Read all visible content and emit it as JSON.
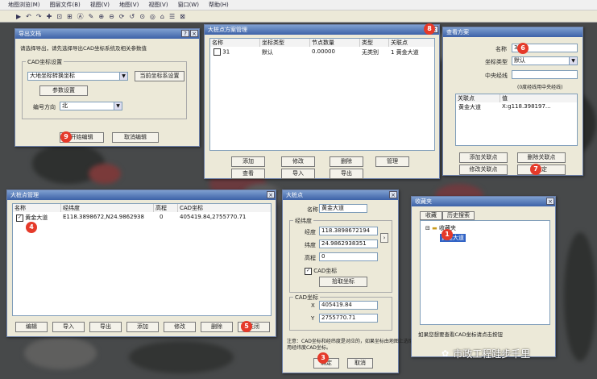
{
  "menubar": {
    "items": [
      "地图浏览(M)",
      "图层文件(B)",
      "视图(V)",
      "地图(V)",
      "视图(V)",
      "窗口(W)",
      "帮助(H)"
    ]
  },
  "toolbar": {
    "glyphs": [
      "▶",
      "↶",
      "↷",
      "✚",
      "⊡",
      "⊞",
      "Ⓐ",
      "✎",
      "⊕",
      "⊖",
      "⟳",
      "↺",
      "⊙",
      "◎",
      "⌂",
      "☰",
      "⊠"
    ]
  },
  "export_win": {
    "title": "导出文档",
    "instruction": "请选择导出，请先选择导出CAD坐标系统及相关参数值",
    "cad_group": "CAD坐标设置",
    "coord_select": "大地坐标转换坐标",
    "cur_coord_btn": "当前坐标系设置",
    "param_btn": "参数设置",
    "dir_label": "编号方向",
    "dir_value": "北",
    "ok_btn": "开始编辑",
    "cancel_btn": "取消编辑",
    "marker": "9"
  },
  "plan_win": {
    "title": "大桩点方案管理",
    "headers": [
      "名称",
      "坐标类型",
      "节点数量",
      "类型",
      "关联点"
    ],
    "row": {
      "name": "31",
      "type": "默认",
      "count": "0.00000",
      "kind": "无类别",
      "rel": "1 黄金大道"
    },
    "buttons": [
      "添加",
      "修改",
      "删除",
      "管理",
      "查看",
      "导入",
      "导出"
    ],
    "marker": "8"
  },
  "detail_win": {
    "title": "查看方案",
    "name_label": "名称",
    "name_value": "31",
    "coord_label": "坐标类型",
    "coord_value": "默认",
    "center_label": "中央经线",
    "hint": "(0度经线用中央经线)",
    "list_headers": [
      "关联点",
      "值"
    ],
    "list_row": {
      "name": "黄金大道",
      "val": "X:g118.398197..."
    },
    "buttons": [
      "添加关联点",
      "删除关联点",
      "修改关联点",
      "确定"
    ],
    "marker6": "6",
    "marker7": "7"
  },
  "points_win": {
    "title": "大桩点管理",
    "headers": [
      "名称",
      "经纬度",
      "高程",
      "CAD坐标"
    ],
    "row": {
      "name": "黄金大道",
      "lnglat": "E118.3898672,N24.9862938",
      "alt": "0",
      "cad": "405419.84,2755770.71"
    },
    "buttons": [
      "编辑",
      "导入",
      "导出",
      "添加",
      "修改",
      "删除",
      "关闭"
    ],
    "marker4": "4",
    "marker5": "5"
  },
  "edit_win": {
    "title": "大桩点",
    "name_label": "名称",
    "name_value": "黄金大道",
    "lnglat_group": "经纬度",
    "lng_label": "经度",
    "lng_value": "118.3898672194",
    "lat_label": "纬度",
    "lat_value": "24.9862938351",
    "alt_label": "高程",
    "alt_value": "0",
    "cad_check": "CAD坐标",
    "pick_btn": "拾取坐标",
    "cad_group": "CAD坐标",
    "x_label": "X",
    "x_value": "405419.84",
    "y_label": "Y",
    "y_value": "2755770.71",
    "note": "注意：CAD坐标和经纬度是对应的，如果坐标由地图上选取则",
    "note2": "用经纬度CAD坐标。",
    "ok_btn": "确定",
    "cancel_btn": "取消",
    "marker": "3"
  },
  "tree_win": {
    "title": "收藏夹",
    "tabs": [
      "收藏",
      "历史搜索"
    ],
    "root": "收藏夹",
    "leaf": "黄金大道",
    "footer": "如果您想要查看CAD坐标请点击按钮",
    "marker": "1"
  },
  "watermark": {
    "text": "市政工程跬步千里"
  }
}
